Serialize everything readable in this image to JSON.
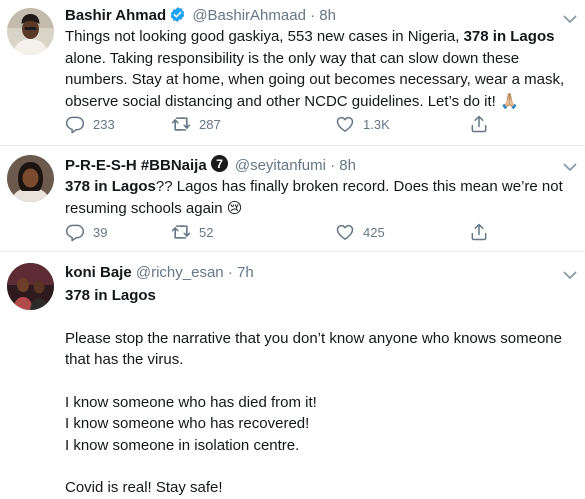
{
  "colors": {
    "verified": "#1da1f2",
    "muted": "#657786",
    "divider": "#e6ecf0"
  },
  "tweets": [
    {
      "name": "Bashir Ahmad",
      "verified": true,
      "handle": "@BashirAhmaad",
      "dot": "·",
      "time": "8h",
      "body_a": "Things not looking good gaskiya, 553 new cases in Nigeria, ",
      "body_bold": "378 in Lagos",
      "body_b": " alone. Taking responsibility is the only way that can slow down these numbers. Stay at home, when going out becomes necessary, wear a mask, observe social distancing and other NCDC guidelines. Let’s do it! 🙏🏼",
      "replies": "233",
      "retweets": "287",
      "likes": "1.3K"
    },
    {
      "name": "P-R-E-S-H #BBNaija",
      "badge": "7",
      "handle": "@seyitanfumi",
      "dot": "·",
      "time": "8h",
      "body_bold": "378 in Lagos",
      "body_b": "?? Lagos has finally broken record. Does this mean we’re not resuming schools again 😢",
      "replies": "39",
      "retweets": "52",
      "likes": "425"
    },
    {
      "name": "koni Baje",
      "handle": "@richy_esan",
      "dot": "·",
      "time": "7h",
      "body_bold": "378 in Lagos",
      "lines": [
        "Please stop the narrative that you don’t know anyone who knows someone that has the virus.",
        "I know someone who has died from it!",
        "I know someone who has recovered!",
        "I know someone in isolation centre.",
        "Covid is real! Stay safe!"
      ]
    }
  ]
}
